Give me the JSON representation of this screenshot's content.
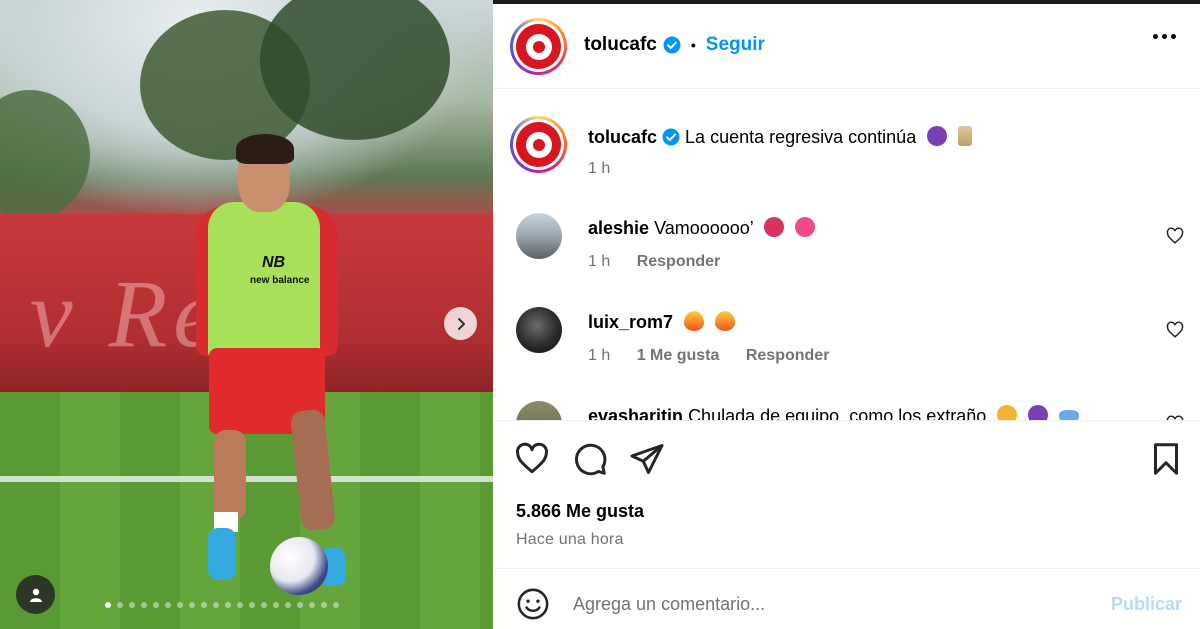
{
  "post": {
    "username": "tolucafc",
    "verified": true,
    "separator": "•",
    "follow_label": "Seguir",
    "more_icon": "more-options-icon"
  },
  "caption": {
    "username": "tolucafc",
    "text": "La cuenta regresiva continúa",
    "emojis": [
      "devil-face",
      "hourglass"
    ],
    "time": "1 h"
  },
  "comments": [
    {
      "username": "aleshie",
      "text": "Vamoooooo’",
      "emojis": [
        "devil-face",
        "heart"
      ],
      "time": "1 h",
      "likes": "",
      "reply": "Responder"
    },
    {
      "username": "luix_rom7",
      "text": "",
      "emojis": [
        "fire",
        "fire"
      ],
      "time": "1 h",
      "likes": "1 Me gusta",
      "reply": "Responder"
    },
    {
      "username": "evasharitin",
      "text": "Chulada de equipo, como los extraño",
      "emojis": [
        "heart-eyes",
        "devil-face",
        "infinity"
      ],
      "time": "",
      "likes": "",
      "reply": ""
    }
  ],
  "stats": {
    "likes": "5.866 Me gusta",
    "time_ago": "Hace una hora"
  },
  "composer": {
    "placeholder": "Agrega un comentario...",
    "publish_label": "Publicar"
  },
  "media": {
    "banner_text": "v Red",
    "shirt_brand": "new balance",
    "carousel_total": 20,
    "carousel_active": 1
  },
  "colors": {
    "link_blue": "#0095f6",
    "publish_disabled": "#b3dbff",
    "muted": "#737373",
    "brand_red": "#d7161f"
  }
}
